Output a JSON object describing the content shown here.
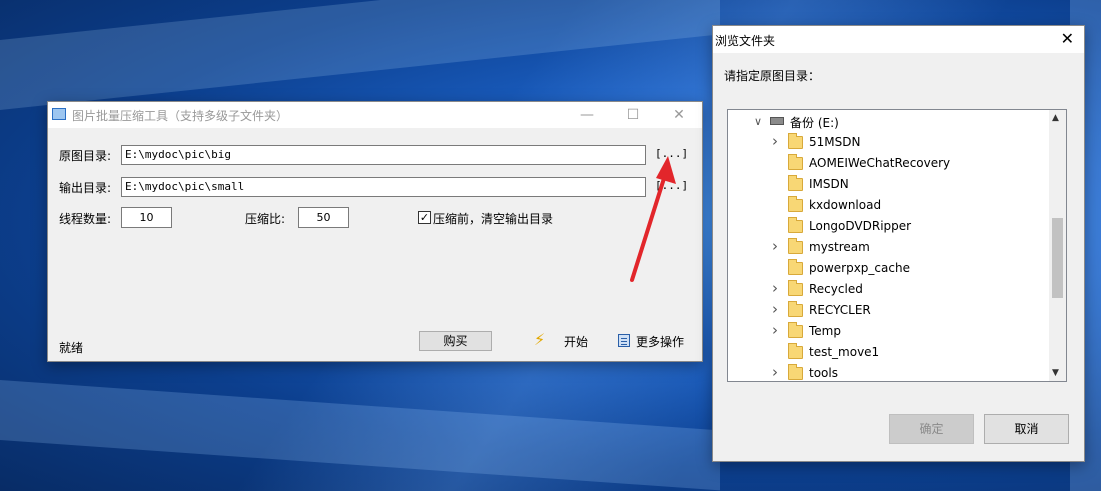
{
  "main_window": {
    "title": "图片批量压缩工具（支持多级子文件夹）",
    "source_label": "原图目录:",
    "source_value": "E:\\mydoc\\pic\\big",
    "output_label": "输出目录:",
    "output_value": "E:\\mydoc\\pic\\small",
    "browse_label": "[...]",
    "thread_label": "线程数量:",
    "thread_value": "10",
    "ratio_label": "压缩比:",
    "ratio_value": "50",
    "clear_checked": true,
    "clear_label": "压缩前，清空输出目录",
    "status": "就绪",
    "buy_label": "购买",
    "start_label": "开始",
    "more_label": "更多操作"
  },
  "dialog": {
    "title": "浏览文件夹",
    "prompt": "请指定原图目录：",
    "drive_label": "备份 (E:)",
    "folders": [
      {
        "name": "51MSDN",
        "expandable": true
      },
      {
        "name": "AOMEIWeChatRecovery",
        "expandable": false
      },
      {
        "name": "IMSDN",
        "expandable": false
      },
      {
        "name": "kxdownload",
        "expandable": false
      },
      {
        "name": "LongoDVDRipper",
        "expandable": false
      },
      {
        "name": "mystream",
        "expandable": true
      },
      {
        "name": "powerpxp_cache",
        "expandable": false
      },
      {
        "name": "Recycled",
        "expandable": true
      },
      {
        "name": "RECYCLER",
        "expandable": true
      },
      {
        "name": "Temp",
        "expandable": true
      },
      {
        "name": "test_move1",
        "expandable": false
      },
      {
        "name": "tools",
        "expandable": true
      }
    ],
    "ok_label": "确定",
    "cancel_label": "取消"
  },
  "colors": {
    "accent_arrow": "#e2262b"
  }
}
